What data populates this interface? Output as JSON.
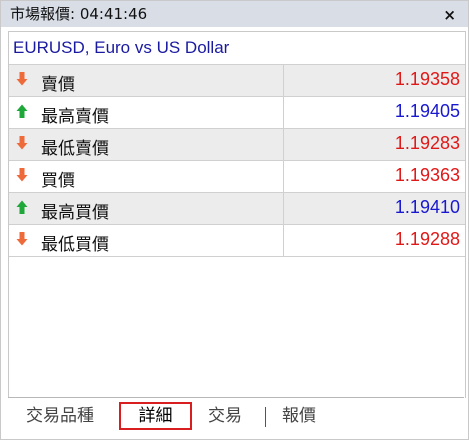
{
  "window": {
    "title": "市場報價: 04:41:46",
    "close_glyph": "×"
  },
  "symbol": {
    "name": "EURUSD, Euro vs US Dollar"
  },
  "rows": [
    {
      "label": "賣價",
      "value": "1.19358",
      "direction": "down",
      "value_color": "#e01818"
    },
    {
      "label": "最高賣價",
      "value": "1.19405",
      "direction": "up",
      "value_color": "#1818d0"
    },
    {
      "label": "最低賣價",
      "value": "1.19283",
      "direction": "down",
      "value_color": "#e01818"
    },
    {
      "label": "買價",
      "value": "1.19363",
      "direction": "down",
      "value_color": "#e01818"
    },
    {
      "label": "最高買價",
      "value": "1.19410",
      "direction": "up",
      "value_color": "#1818d0"
    },
    {
      "label": "最低買價",
      "value": "1.19288",
      "direction": "down",
      "value_color": "#e01818"
    }
  ],
  "arrow_icons": {
    "down": "arrow-down-icon",
    "up": "arrow-up-icon"
  },
  "colors": {
    "down_arrow": "#ee6a3a",
    "up_arrow": "#1fa83a",
    "active_tab_border": "#d81e1e"
  },
  "tabs": [
    {
      "label": "交易品種",
      "active": false
    },
    {
      "label": "詳細",
      "active": true
    },
    {
      "label": "交易",
      "active": false
    },
    {
      "label": "報價",
      "active": false
    }
  ]
}
